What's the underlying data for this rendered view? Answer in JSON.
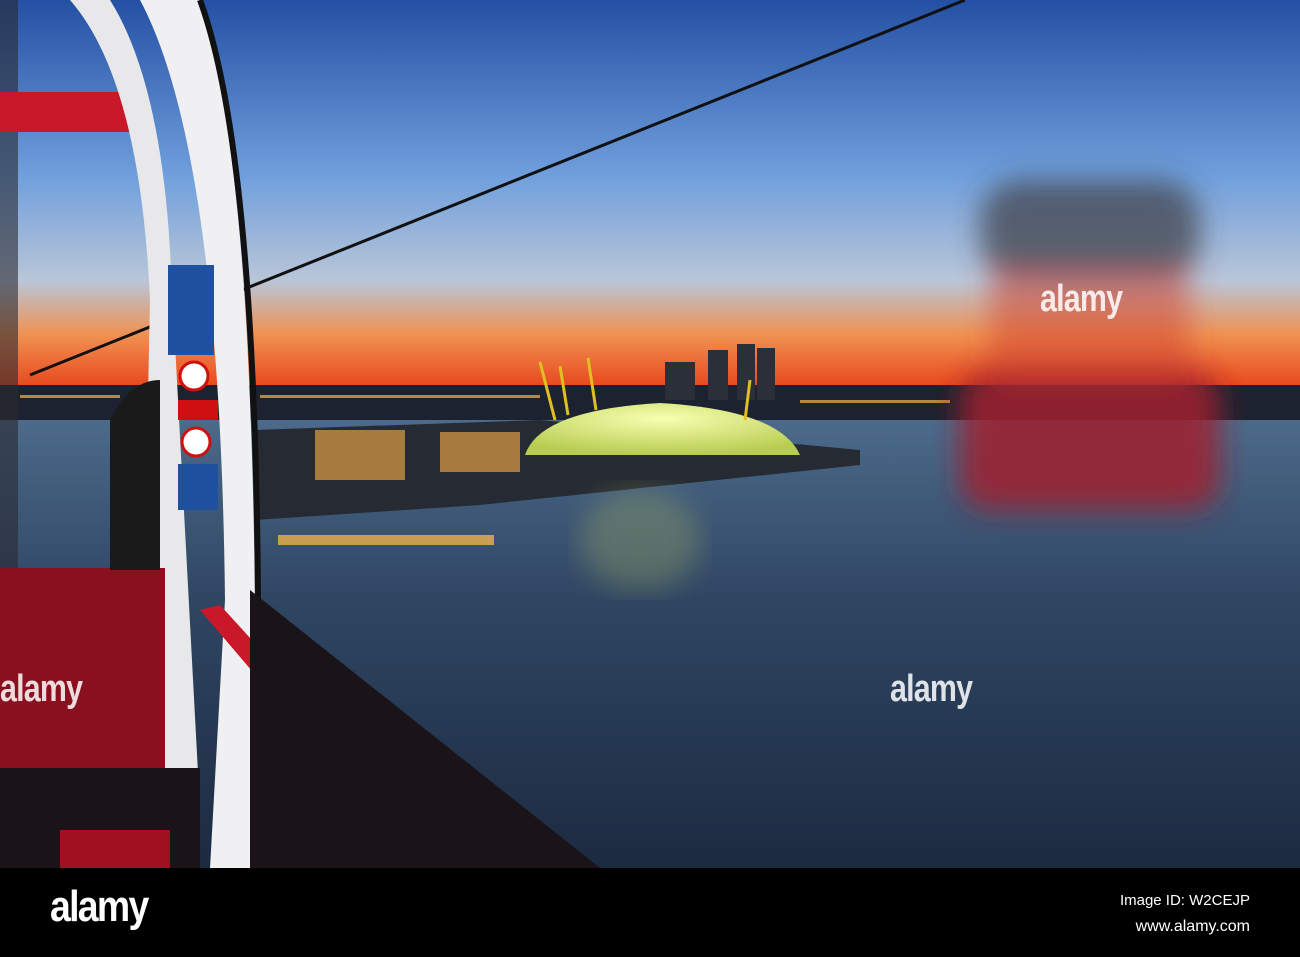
{
  "watermark": {
    "text": "alamy"
  },
  "footer": {
    "logo": "alamy",
    "image_id": "Image ID: W2CEJP",
    "url": "www.alamy.com"
  },
  "colors": {
    "sky_top": "#2456a8",
    "horizon": "#f05a1a",
    "water": "#2a3f5c",
    "cabin_red": "#c0182a",
    "dome": "#e8f080"
  }
}
